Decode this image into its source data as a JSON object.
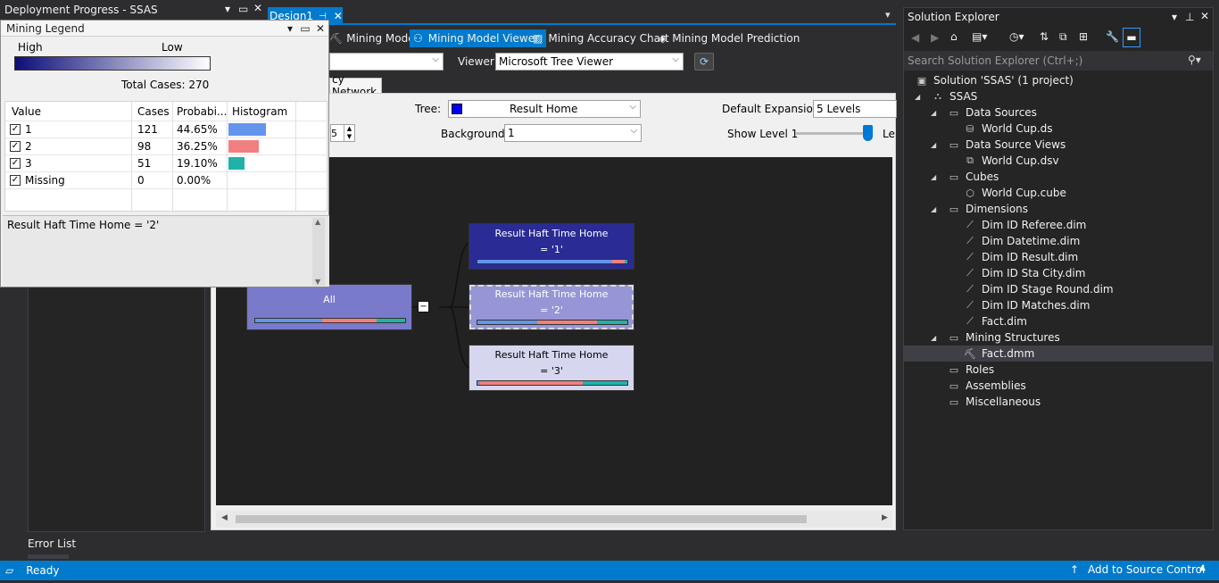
{
  "left_panel": {
    "title": "Deployment Progress - SSAS",
    "error_list": "Error List"
  },
  "legend": {
    "title": "Mining Legend",
    "high": "High",
    "low": "Low",
    "total_cases": "Total Cases:  270",
    "headers": [
      "Value",
      "Cases",
      "Probabi...",
      "Histogram"
    ],
    "rows": [
      {
        "value": "1",
        "cases": "121",
        "prob": "44.65%",
        "fraction": 0.4465,
        "color": "#6495ed"
      },
      {
        "value": "2",
        "cases": "98",
        "prob": "36.25%",
        "fraction": 0.3625,
        "color": "#f08080"
      },
      {
        "value": "3",
        "cases": "51",
        "prob": "19.10%",
        "fraction": 0.191,
        "color": "#20b2aa"
      },
      {
        "value": "Missing",
        "cases": "0",
        "prob": "0.00%",
        "fraction": 0,
        "color": "#ffffff"
      }
    ],
    "description": "Result Haft Time Home = '2'"
  },
  "doc": {
    "tab": "Design1",
    "tabs": [
      "Mining Models",
      "Mining Model Viewer",
      "Mining Accuracy Chart",
      "Mining Model Prediction"
    ],
    "viewer_label": "Viewer:",
    "viewer_value": "Microsoft Tree Viewer",
    "sub_tab": "cy Network",
    "tree_label": "Tree:",
    "tree_value": "Result Home",
    "default_expansion_label": "Default Expansion:",
    "default_expansion_value": "5 Levels",
    "background_label": "Background:",
    "background_value": "1",
    "show_level": "Show Level 1",
    "level_cut": "Le",
    "spin_value": "5"
  },
  "tree": {
    "root": {
      "label": "All",
      "bar": [
        0.4465,
        0.3625,
        0.191
      ]
    },
    "children": [
      {
        "line1": "Result Haft Time Home",
        "line2": "= '1'",
        "bar": [
          0.9,
          0.08,
          0.02
        ]
      },
      {
        "line1": "Result Haft Time Home",
        "line2": "= '2'",
        "bar": [
          0.4,
          0.4,
          0.2
        ]
      },
      {
        "line1": "Result Haft Time Home",
        "line2": "= '3'",
        "bar": [
          0.02,
          0.68,
          0.3
        ]
      }
    ]
  },
  "solution_explorer": {
    "title": "Solution Explorer",
    "search_placeholder": "Search Solution Explorer (Ctrl+;)",
    "solution": "Solution 'SSAS' (1 project)",
    "project": "SSAS",
    "folders": [
      {
        "name": "Data Sources",
        "items": [
          "World Cup.ds"
        ]
      },
      {
        "name": "Data Source Views",
        "items": [
          "World Cup.dsv"
        ]
      },
      {
        "name": "Cubes",
        "items": [
          "World Cup.cube"
        ]
      },
      {
        "name": "Dimensions",
        "items": [
          "Dim ID Referee.dim",
          "Dim Datetime.dim",
          "Dim ID Result.dim",
          "Dim ID Sta City.dim",
          "Dim ID Stage Round.dim",
          "Dim ID Matches.dim",
          "Fact.dim"
        ]
      },
      {
        "name": "Mining Structures",
        "items": [
          "Fact.dmm"
        ]
      },
      {
        "name": "Roles",
        "items": []
      },
      {
        "name": "Assemblies",
        "items": []
      },
      {
        "name": "Miscellaneous",
        "items": []
      }
    ]
  },
  "status": {
    "ready": "Ready",
    "source_control": "Add to Source Control"
  }
}
